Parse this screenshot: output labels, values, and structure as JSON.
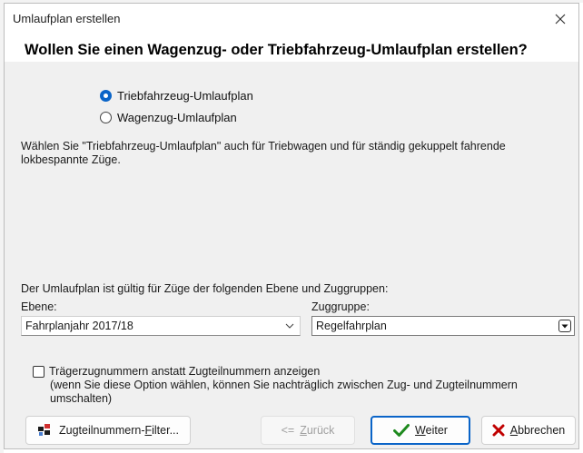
{
  "window": {
    "title": "Umlaufplan erstellen",
    "headline": "Wollen Sie einen Wagenzug- oder Triebfahrzeug-Umlaufplan erstellen?"
  },
  "plan_type": {
    "options": [
      {
        "label": "Triebfahrzeug-Umlaufplan",
        "selected": true
      },
      {
        "label": "Wagenzug-Umlaufplan",
        "selected": false
      }
    ],
    "hint_line1": "Wählen Sie \"Triebfahrzeug-Umlaufplan\" auch für Triebwagen und für ständig gekuppelt fahrende",
    "hint_line2": "lokbespannte Züge."
  },
  "scope": {
    "description": "Der Umlaufplan ist gültig für Züge der folgenden Ebene und Zuggruppen:",
    "ebene_label": "Ebene:",
    "ebene_value": "Fahrplanjahr 2017/18",
    "zuggruppe_label": "Zuggruppe:",
    "zuggruppe_value": "Regelfahrplan"
  },
  "option": {
    "checked": false,
    "label": "Trägerzugnummern anstatt Zugteilnummern anzeigen",
    "note_line1": "(wenn Sie diese Option wählen, können Sie nachträglich zwischen Zug- und Zugteilnummern",
    "note_line2": "umschalten)"
  },
  "buttons": {
    "filter_pre": "Zugteilnummern-",
    "filter_key": "F",
    "filter_post": "ilter...",
    "back_arrow": "<=",
    "back_key": "Z",
    "back_post": "urück",
    "next_key": "W",
    "next_post": "eiter",
    "cancel_key": "A",
    "cancel_post": "bbrechen"
  },
  "colors": {
    "accent": "#0a64c8",
    "next_check": "#1e8a1e",
    "cancel_x": "#c00000"
  },
  "icons": [
    "close-icon",
    "radio-selected-icon",
    "radio-unselected-icon",
    "chevron-down-icon",
    "dropdown-arrow-icon",
    "filter-icon",
    "checkmark-icon",
    "cancel-x-icon"
  ]
}
